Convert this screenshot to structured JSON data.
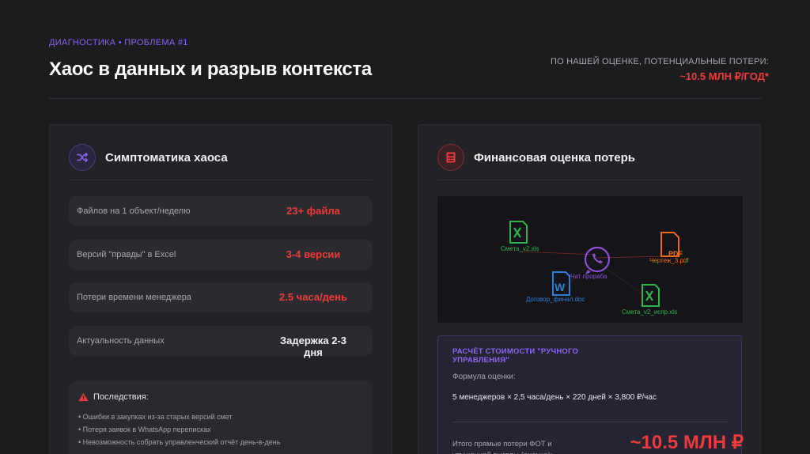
{
  "header": {
    "eyebrow": "ДИАГНОСТИКА • ПРОБЛЕМА #1",
    "title": "Хаос в данных и разрыв контекста",
    "loss_note": "ПО НАШЕЙ ОЦЕНКЕ, ПОТЕНЦИАЛЬНЫЕ ПОТЕРИ:",
    "loss_value": "~10.5 МЛН ₽/ГОД*"
  },
  "symptoms": {
    "title": "Симптоматика хаоса",
    "icon": "shuffle-icon",
    "rows": [
      {
        "label": "Файлов на 1 объект/неделю",
        "value": "23+ файла",
        "color": "#ee3b3b"
      },
      {
        "label": "Версий \"правды\" в Excel",
        "value": "3-4 версии",
        "color": "#ee3b3b"
      },
      {
        "label": "Потери времени менеджера",
        "value": "2.5 часа/день",
        "color": "#ee3b3b"
      },
      {
        "label": "Актуальность данных",
        "value": "Задержка 2-3 дня",
        "color": "#f2f2f4"
      }
    ],
    "consequences": {
      "title": "Последствия:",
      "items": [
        "• Ошибки в закупках из-за старых версий смет",
        "• Потеря заявок в WhatsApp переписках",
        "• Невозможность собрать управленческий отчёт день-в-день"
      ]
    }
  },
  "finance": {
    "title": "Финансовая оценка потерь",
    "icon": "calculator-icon",
    "illustration": {
      "files": [
        {
          "name": "Смета_v2.xls",
          "type": "excel-icon"
        },
        {
          "name": "Чертеж_3.pdf",
          "type": "pdf-icon"
        },
        {
          "name": "Чат прораба",
          "type": "whatsapp-icon"
        },
        {
          "name": "Договор_финал.doc",
          "type": "word-icon"
        },
        {
          "name": "Смета_v2_испр.xls",
          "type": "excel-icon"
        }
      ]
    },
    "calc": {
      "title": "РАСЧЁТ СТОИМОСТИ \"РУЧНОГО УПРАВЛЕНИЯ\"",
      "formula_label": "Формула оценки:",
      "formula": "5 менеджеров × 2,5 часа/день × 220 дней × 3,800 ₽/час",
      "total_label": "Итого прямые потери ФОТ и упущенной выгоды (оценка):",
      "total": "~10.5 МЛН ₽"
    }
  },
  "colors": {
    "accent_purple": "#8b64f2",
    "accent_red": "#ee3b3b",
    "excel": "#2fb34e",
    "word": "#2b7fd9",
    "pdf": "#f06a1e",
    "whatsapp": "#8b4fd8"
  }
}
